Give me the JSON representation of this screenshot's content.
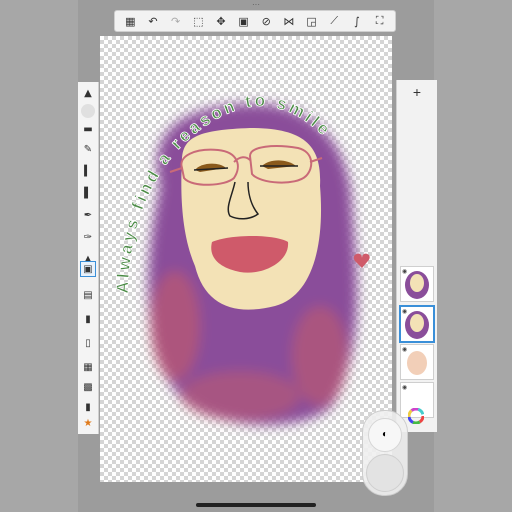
{
  "toolbar": {
    "items": [
      {
        "name": "gallery-icon",
        "glyph": "▦"
      },
      {
        "name": "undo-icon",
        "glyph": "↶"
      },
      {
        "name": "redo-icon",
        "glyph": "↷"
      },
      {
        "name": "select-icon",
        "glyph": "⬚"
      },
      {
        "name": "move-icon",
        "glyph": "✥"
      },
      {
        "name": "crop-icon",
        "glyph": "▣"
      },
      {
        "name": "ruler-icon",
        "glyph": "⊘"
      },
      {
        "name": "symmetry-icon",
        "glyph": "⋈"
      },
      {
        "name": "shapes-icon",
        "glyph": "◲"
      },
      {
        "name": "perspective-icon",
        "glyph": "⟋"
      },
      {
        "name": "stroke-icon",
        "glyph": "∫"
      },
      {
        "name": "fullscreen-icon",
        "glyph": "⛶"
      }
    ]
  },
  "artwork": {
    "arc_text": "Always find a reason to smile",
    "text_color": "#4a8a45",
    "hair_color": "#8a4e9a",
    "hair_accent": "#c45a6a",
    "face_color": "#f3e2b6",
    "mouth_color": "#cf5a6a",
    "glasses_color": "#c96a78",
    "eye_color": "#8a5a1c"
  },
  "layers_panel": {
    "add_label": "+",
    "eye_glyph": "◉"
  },
  "puck": {
    "top_label": "◐"
  }
}
